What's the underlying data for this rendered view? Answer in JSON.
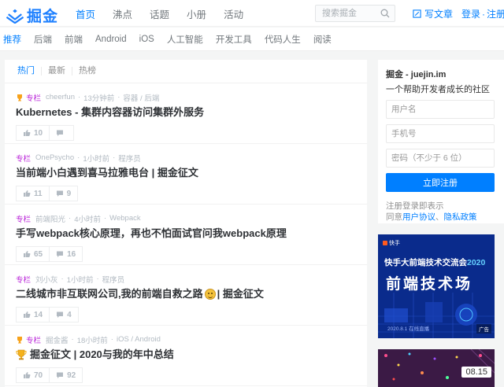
{
  "brand": {
    "name": "掘金",
    "color": "#007fff"
  },
  "nav": {
    "items": [
      "首页",
      "沸点",
      "话题",
      "小册",
      "活动"
    ],
    "active": 0
  },
  "search": {
    "placeholder": "搜索掘金"
  },
  "write": {
    "label": "写文章"
  },
  "auth": {
    "login": "登录",
    "separator": "·",
    "register": "注册"
  },
  "subnav": {
    "items": [
      "推荐",
      "后端",
      "前端",
      "Android",
      "iOS",
      "人工智能",
      "开发工具",
      "代码人生",
      "阅读"
    ],
    "active": 0
  },
  "feed": {
    "tabs": [
      "热门",
      "最新",
      "热榜"
    ],
    "active_tab": 0,
    "entries": [
      {
        "column": "专栏",
        "author": "cheerfun",
        "time": "13分钟前",
        "tags": "容器 / 后端",
        "title": "Kubernetes - 集群内容器访问集群外服务",
        "likes": "10",
        "comments": "",
        "icon": "trophy-icon"
      },
      {
        "column": "专栏",
        "author": "OnePsycho",
        "time": "1小时前",
        "tags": "程序员",
        "title": "当前端小白遇到喜马拉雅电台 | 掘金征文",
        "likes": "11",
        "comments": "9",
        "icon": ""
      },
      {
        "column": "专栏",
        "author": "前端阳光",
        "time": "4小时前",
        "tags": "Webpack",
        "title": "手写webpack核心原理，再也不怕面试官问我webpack原理",
        "likes": "65",
        "comments": "16",
        "icon": ""
      },
      {
        "column": "专栏",
        "author": "刘小灰",
        "time": "1小时前",
        "tags": "程序员",
        "title_a": "二线城市非互联网公司,我的前端自救之路",
        "title_b": "| 掘金征文",
        "likes": "14",
        "comments": "4",
        "icon": ""
      },
      {
        "column": "专栏",
        "author": "掘金酱",
        "time": "18小时前",
        "tags": "iOS / Android",
        "title": "掘金征文 | 2020与我的年中总结",
        "likes": "70",
        "comments": "92",
        "icon": "trophy-icon"
      }
    ]
  },
  "sidebar": {
    "site": "掘金 - juejin.im",
    "slogan": "一个帮助开发者成长的社区",
    "username_placeholder": "用户名",
    "phone_placeholder": "手机号",
    "password_placeholder": "密码（不少于 6 位）",
    "register_button": "立即注册",
    "legal_line1": "注册登录即表示",
    "legal_agree": "同意",
    "legal_terms": "用户协议",
    "legal_sep": "、",
    "legal_privacy": "隐私政策"
  },
  "ads": {
    "ad1": {
      "brand": "快手",
      "line1_a": "快手大前端技术交流会",
      "line1_b": "2020",
      "line2": "前端技术场",
      "date": "2020.8.1  在线直播",
      "badge": "广告"
    },
    "ad2": {
      "time": "08.15"
    }
  }
}
